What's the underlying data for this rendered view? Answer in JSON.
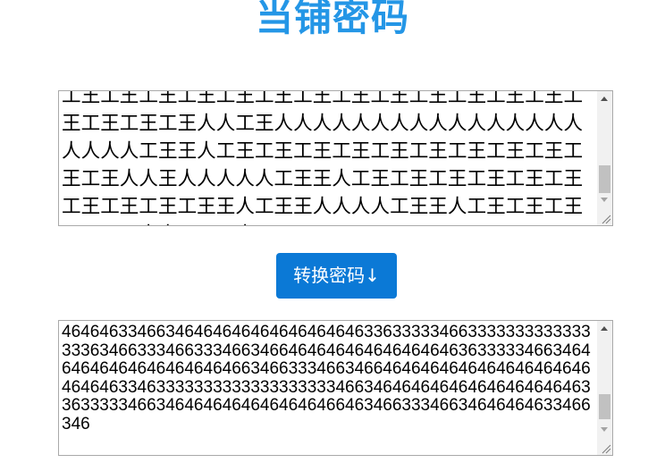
{
  "page": {
    "title": "当铺密码"
  },
  "input_box": {
    "value": "工王工王工王工王工王工王工王工王工王工王工王工王工王工王工王工王工王人人工王人人人人人人人人人人人人人人人人人人人人工王王人工王工王工王工王工王工王工王工王工王工王工王人人王人人人人人工王王人工王工王工王工王工王工王工王工王工王工王王人工王王人人人人工王王人工王工王工王工王工王人人工王王人工王"
  },
  "convert_button": {
    "label": "转换密码↓"
  },
  "output_box": {
    "value": "4646463346634646464646464646464633633333466333333333333333363466333466333466346646464646464646464636333334663464646464646464646464663466333466346646464646464646464646464646463346333333333333333333346634646464646464646464646336333334663464646464646464646646346633346634646464633466346"
  },
  "colors": {
    "title": "#2496e6",
    "button_bg": "#0b79d6",
    "button_text": "#ffffff",
    "border": "#a9a9a9"
  }
}
